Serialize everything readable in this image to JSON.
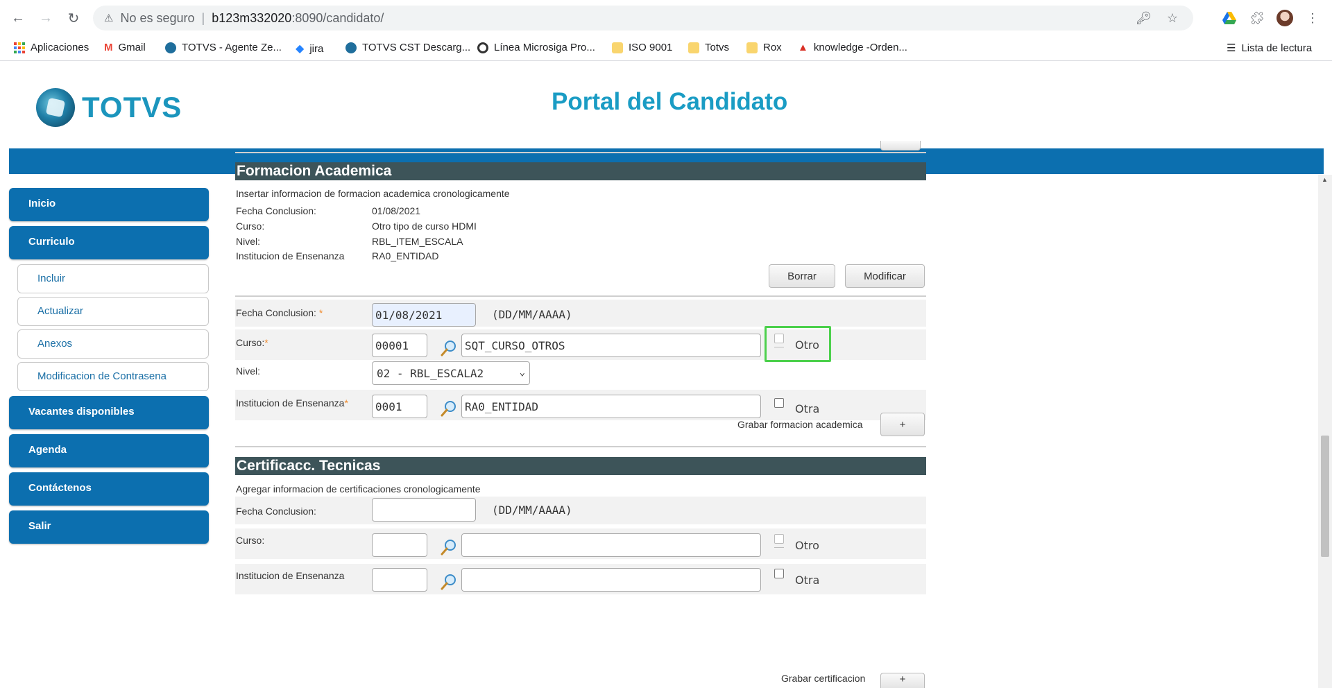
{
  "browser": {
    "insecure_label": "No es seguro",
    "url_host": "b123m332020",
    "url_path": ":8090/candidato/",
    "bookmarks": [
      "Aplicaciones",
      "Gmail",
      "TOTVS - Agente Ze...",
      "jira",
      "TOTVS CST Descarg...",
      "Línea Microsiga Pro...",
      "ISO 9001",
      "Totvs",
      "Rox",
      "knowledge -Orden..."
    ],
    "reading_list": "Lista de lectura"
  },
  "header": {
    "logo_text": "TOTVS",
    "title": "Portal del Candidato"
  },
  "sidebar": {
    "items": [
      {
        "label": "Inicio"
      },
      {
        "label": "Curriculo"
      },
      {
        "label": "Incluir"
      },
      {
        "label": "Actualizar"
      },
      {
        "label": "Anexos"
      },
      {
        "label": "Modificacion de Contrasena"
      },
      {
        "label": "Vacantes disponibles"
      },
      {
        "label": "Agenda"
      },
      {
        "label": "Contáctenos"
      },
      {
        "label": "Salir"
      }
    ]
  },
  "formacion": {
    "title": "Formacion Academica",
    "subtitle": "Insertar informacion de formacion academica cronologicamente",
    "record": {
      "labels": [
        "Fecha Conclusion:",
        "Curso:",
        "Nivel:",
        "Institucion de Ensenanza"
      ],
      "values": [
        "01/08/2021",
        "Otro tipo de curso HDMI",
        "RBL_ITEM_ESCALA",
        "RA0_ENTIDAD"
      ]
    },
    "borrar": "Borrar",
    "modificar": "Modificar",
    "form": {
      "fecha_label": "Fecha Conclusion:",
      "required_mark": "*",
      "fecha_value": "01/08/2021",
      "date_hint": "(DD/MM/AAAA)",
      "curso_label": "Curso:",
      "curso_code": "00001",
      "curso_desc": "SQT_CURSO_OTROS",
      "otro_label": "Otro",
      "nivel_label": "Nivel:",
      "nivel_value": "02 - RBL_ESCALA2",
      "inst_label": "Institucion de Ensenanza",
      "inst_code": "0001",
      "inst_desc": "RA0_ENTIDAD",
      "otra_label": "Otra",
      "save_label": "Grabar formacion academica",
      "add_label": "+"
    }
  },
  "certificacion": {
    "title": "Certificacc. Tecnicas",
    "subtitle": "Agregar informacion de certificaciones cronologicamente",
    "fecha_label": "Fecha Conclusion:",
    "date_hint": "(DD/MM/AAAA)",
    "curso_label": "Curso:",
    "otro_label": "Otro",
    "inst_label": "Institucion de Ensenanza",
    "otra_label": "Otra",
    "save_label": "Grabar certificacion",
    "add_label": "+"
  }
}
